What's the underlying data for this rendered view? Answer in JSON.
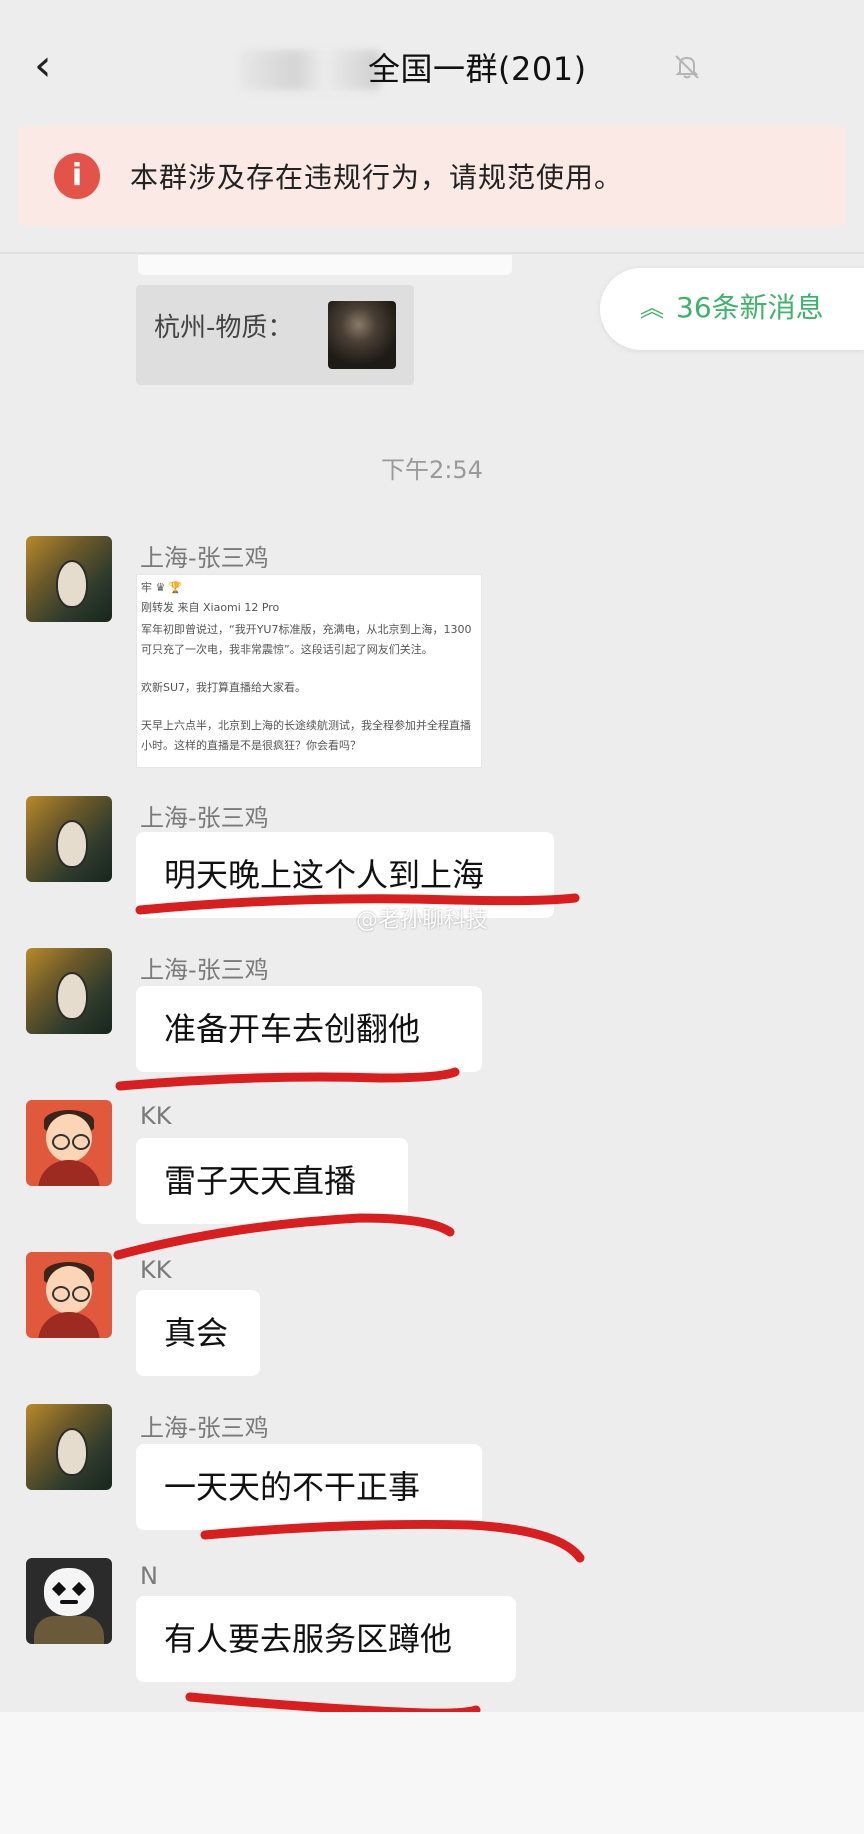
{
  "header": {
    "back_icon": "chevron-left-icon",
    "title": "全国一群(201)",
    "mute_icon": "bell-muted-icon"
  },
  "notice": {
    "icon": "info-icon",
    "icon_glyph": "i",
    "text": "本群涉及存在违规行为，请规范使用。"
  },
  "shared_card": {
    "label": "杭州-物质："
  },
  "new_messages": {
    "icon": "double-chevron-up-icon",
    "icon_glyph": "≈",
    "label": "36条新消息"
  },
  "timestamp": "下午2:54",
  "messages": [
    {
      "sender": "上海-张三鸡",
      "type": "image"
    },
    {
      "sender": "上海-张三鸡",
      "text": "明天晚上这个人到上海"
    },
    {
      "sender": "上海-张三鸡",
      "text": "准备开车去创翻他"
    },
    {
      "sender": "KK",
      "text": "雷子天天直播"
    },
    {
      "sender": "KK",
      "text": "真会"
    },
    {
      "sender": "上海-张三鸡",
      "text": "一天天的不干正事"
    },
    {
      "sender": "N",
      "text": "有人要去服务区蹲他"
    }
  ],
  "shared_image_lines": [
    "牢 ♛ 🏆",
    "刚转发 来自 Xiaomi 12 Pro",
    "军年初即曾说过，“我开YU7标准版，充满电，从北京到上海，1300",
    "可只充了一次电，我非常震惊”。这段话引起了网友们关注。",
    "欢新SU7，我打算直播给大家看。",
    "天早上六点半，北京到上海的长途续航测试，我全程参加并全程直播",
    "小时。这样的直播是不是很疯狂？你会看吗？"
  ],
  "watermark": "@老孙聊科技",
  "colors": {
    "background": "#ededed",
    "accent_green": "#3fb36b",
    "notice_bg": "#fae9e4",
    "notice_icon": "#e4534a",
    "underline_red": "#d81e1e"
  }
}
